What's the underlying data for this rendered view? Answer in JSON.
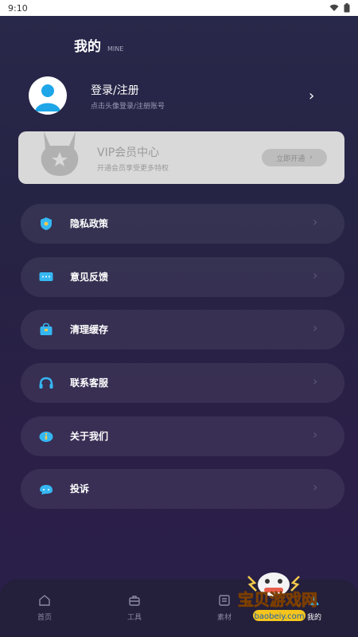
{
  "status": {
    "time": "9:10"
  },
  "page": {
    "title_cn": "我的",
    "title_en": "MINE"
  },
  "login": {
    "title": "登录/注册",
    "subtitle": "点击头像登录/注册账号"
  },
  "vip": {
    "title": "VIP会员中心",
    "subtitle": "开通会员享受更多特权",
    "button": "立即开通"
  },
  "menu": [
    {
      "label": "隐私政策",
      "icon": "shield-icon"
    },
    {
      "label": "意见反馈",
      "icon": "chat-icon"
    },
    {
      "label": "清理缓存",
      "icon": "bag-icon"
    },
    {
      "label": "联系客服",
      "icon": "headset-icon"
    },
    {
      "label": "关于我们",
      "icon": "info-icon"
    },
    {
      "label": "投诉",
      "icon": "complaint-icon"
    }
  ],
  "nav": [
    {
      "label": "首页",
      "icon": "home-icon"
    },
    {
      "label": "工具",
      "icon": "toolbox-icon"
    },
    {
      "label": "素材",
      "icon": "material-icon"
    },
    {
      "label": "我的",
      "icon": "profile-icon"
    }
  ],
  "watermark": {
    "brand": "宝贝游戏网",
    "url": "baobeiy.com"
  },
  "colors": {
    "accent": "#35b7f2",
    "bg": "#272345",
    "card": "#d9d9d9"
  }
}
